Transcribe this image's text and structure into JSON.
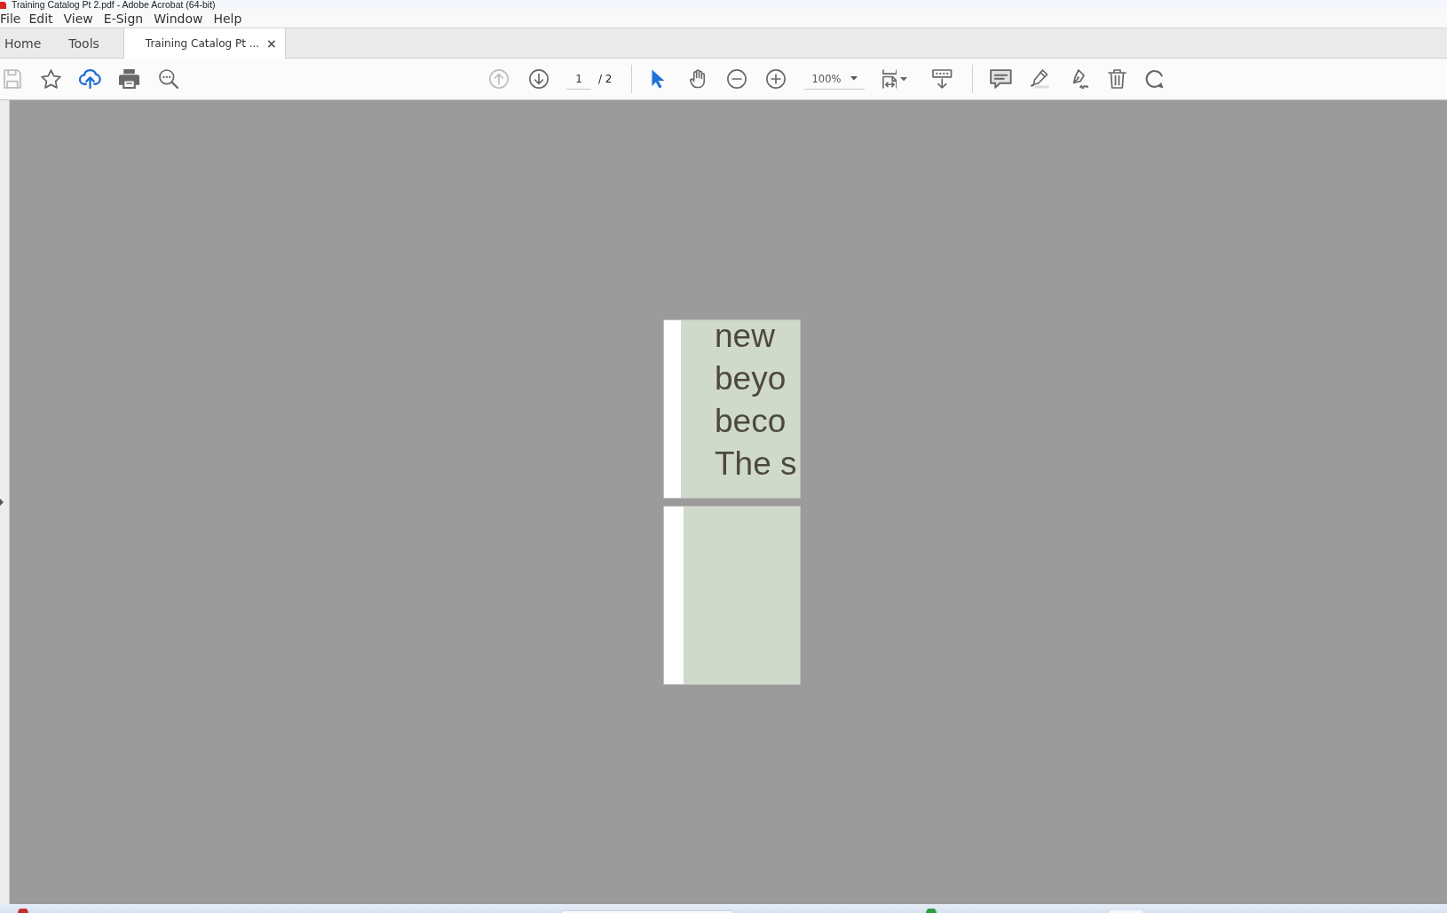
{
  "window": {
    "title": "Training Catalog Pt 2.pdf - Adobe Acrobat (64-bit)"
  },
  "menu": [
    "File",
    "Edit",
    "View",
    "E-Sign",
    "Window",
    "Help"
  ],
  "tabs": [
    {
      "label": "Home",
      "selected": false
    },
    {
      "label": "Tools",
      "selected": false
    },
    {
      "label": "Training Catalog Pt ...",
      "selected": true,
      "close": "×"
    }
  ],
  "toolbar": {
    "file_tools": [
      {
        "kind": "save",
        "disabled": true
      },
      {
        "kind": "bookmark",
        "disabled": false
      },
      {
        "kind": "upload",
        "disabled": false
      },
      {
        "kind": "print",
        "disabled": false
      },
      {
        "kind": "find",
        "disabled": false
      }
    ],
    "nav_tools": [
      {
        "kind": "previous-page",
        "disabled": true
      },
      {
        "kind": "next-page",
        "disabled": false
      }
    ],
    "page_field": {
      "value": "1"
    },
    "page_total": "/ 2",
    "pointer_tools": [
      {
        "kind": "select",
        "selected": true
      },
      {
        "kind": "hand",
        "selected": false
      }
    ],
    "zoom_tools": [
      {
        "kind": "zoom-out"
      },
      {
        "kind": "zoom-in"
      }
    ],
    "zoom_field": {
      "value": "100%"
    },
    "view_tools": [
      {
        "kind": "page-fit"
      },
      {
        "kind": "scroll-mode"
      }
    ],
    "edit_tools": [
      {
        "kind": "comment"
      },
      {
        "kind": "highlight"
      },
      {
        "kind": "sign"
      },
      {
        "kind": "delete"
      },
      {
        "kind": "rotate"
      }
    ]
  },
  "document": {
    "pages": [
      {
        "kind": "text",
        "lines": [
          "new",
          "beyo",
          "beco",
          "The s"
        ]
      },
      {
        "kind": "blank"
      }
    ]
  }
}
